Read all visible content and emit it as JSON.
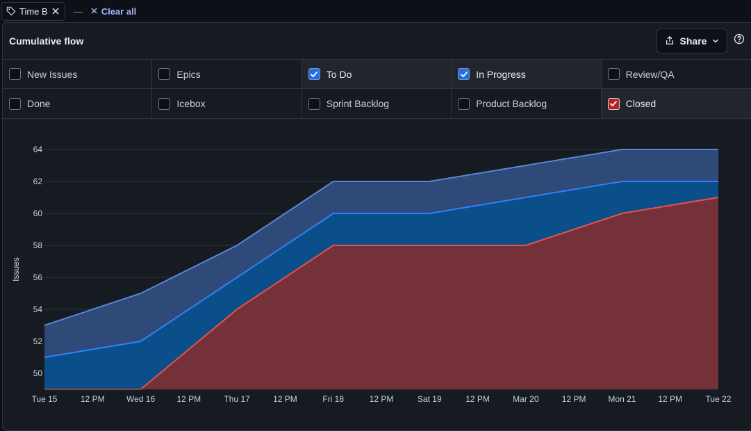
{
  "filter_chip": {
    "label": "Time B"
  },
  "clear_all": {
    "label": "Clear all"
  },
  "panel": {
    "title": "Cumulative flow",
    "share_label": "Share"
  },
  "statuses": [
    {
      "label": "New Issues",
      "checked": false,
      "color": ""
    },
    {
      "label": "Epics",
      "checked": false,
      "color": ""
    },
    {
      "label": "To Do",
      "checked": true,
      "color": "#1f6feb"
    },
    {
      "label": "In Progress",
      "checked": true,
      "color": "#1f6feb"
    },
    {
      "label": "Review/QA",
      "checked": false,
      "color": ""
    },
    {
      "label": "Done",
      "checked": false,
      "color": ""
    },
    {
      "label": "Icebox",
      "checked": false,
      "color": ""
    },
    {
      "label": "Sprint Backlog",
      "checked": false,
      "color": ""
    },
    {
      "label": "Product Backlog",
      "checked": false,
      "color": ""
    },
    {
      "label": "Closed",
      "checked": true,
      "color": "#b62324"
    }
  ],
  "chart_data": {
    "type": "area",
    "ylabel": "Issues",
    "ylim": [
      49,
      64
    ],
    "y_ticks": [
      50,
      52,
      54,
      56,
      58,
      60,
      62,
      64
    ],
    "x_tick_labels": [
      "Tue 15",
      "12 PM",
      "Wed 16",
      "12 PM",
      "Thu 17",
      "12 PM",
      "Fri 18",
      "12 PM",
      "Sat 19",
      "12 PM",
      "Mar 20",
      "12 PM",
      "Mon 21",
      "12 PM",
      "Tue 22"
    ],
    "x_points": [
      "Tue 15",
      "Wed 16",
      "Thu 17",
      "Fri 18",
      "Sat 19",
      "Mar 20",
      "Mon 21",
      "Tue 22"
    ],
    "series": [
      {
        "color": "#5a85d6",
        "fill": "#2f4a78",
        "values": [
          53,
          55,
          58,
          62,
          62,
          63,
          64,
          64
        ]
      },
      {
        "color": "#2f81f7",
        "fill": "#0b4f8a",
        "values": [
          51,
          52,
          56,
          60,
          60,
          61,
          62,
          62
        ]
      },
      {
        "color": "#e5534b",
        "fill": "#74313a",
        "values": [
          49,
          49,
          54,
          58,
          58,
          58,
          60,
          61
        ]
      }
    ],
    "grid": true,
    "legend": "none"
  }
}
